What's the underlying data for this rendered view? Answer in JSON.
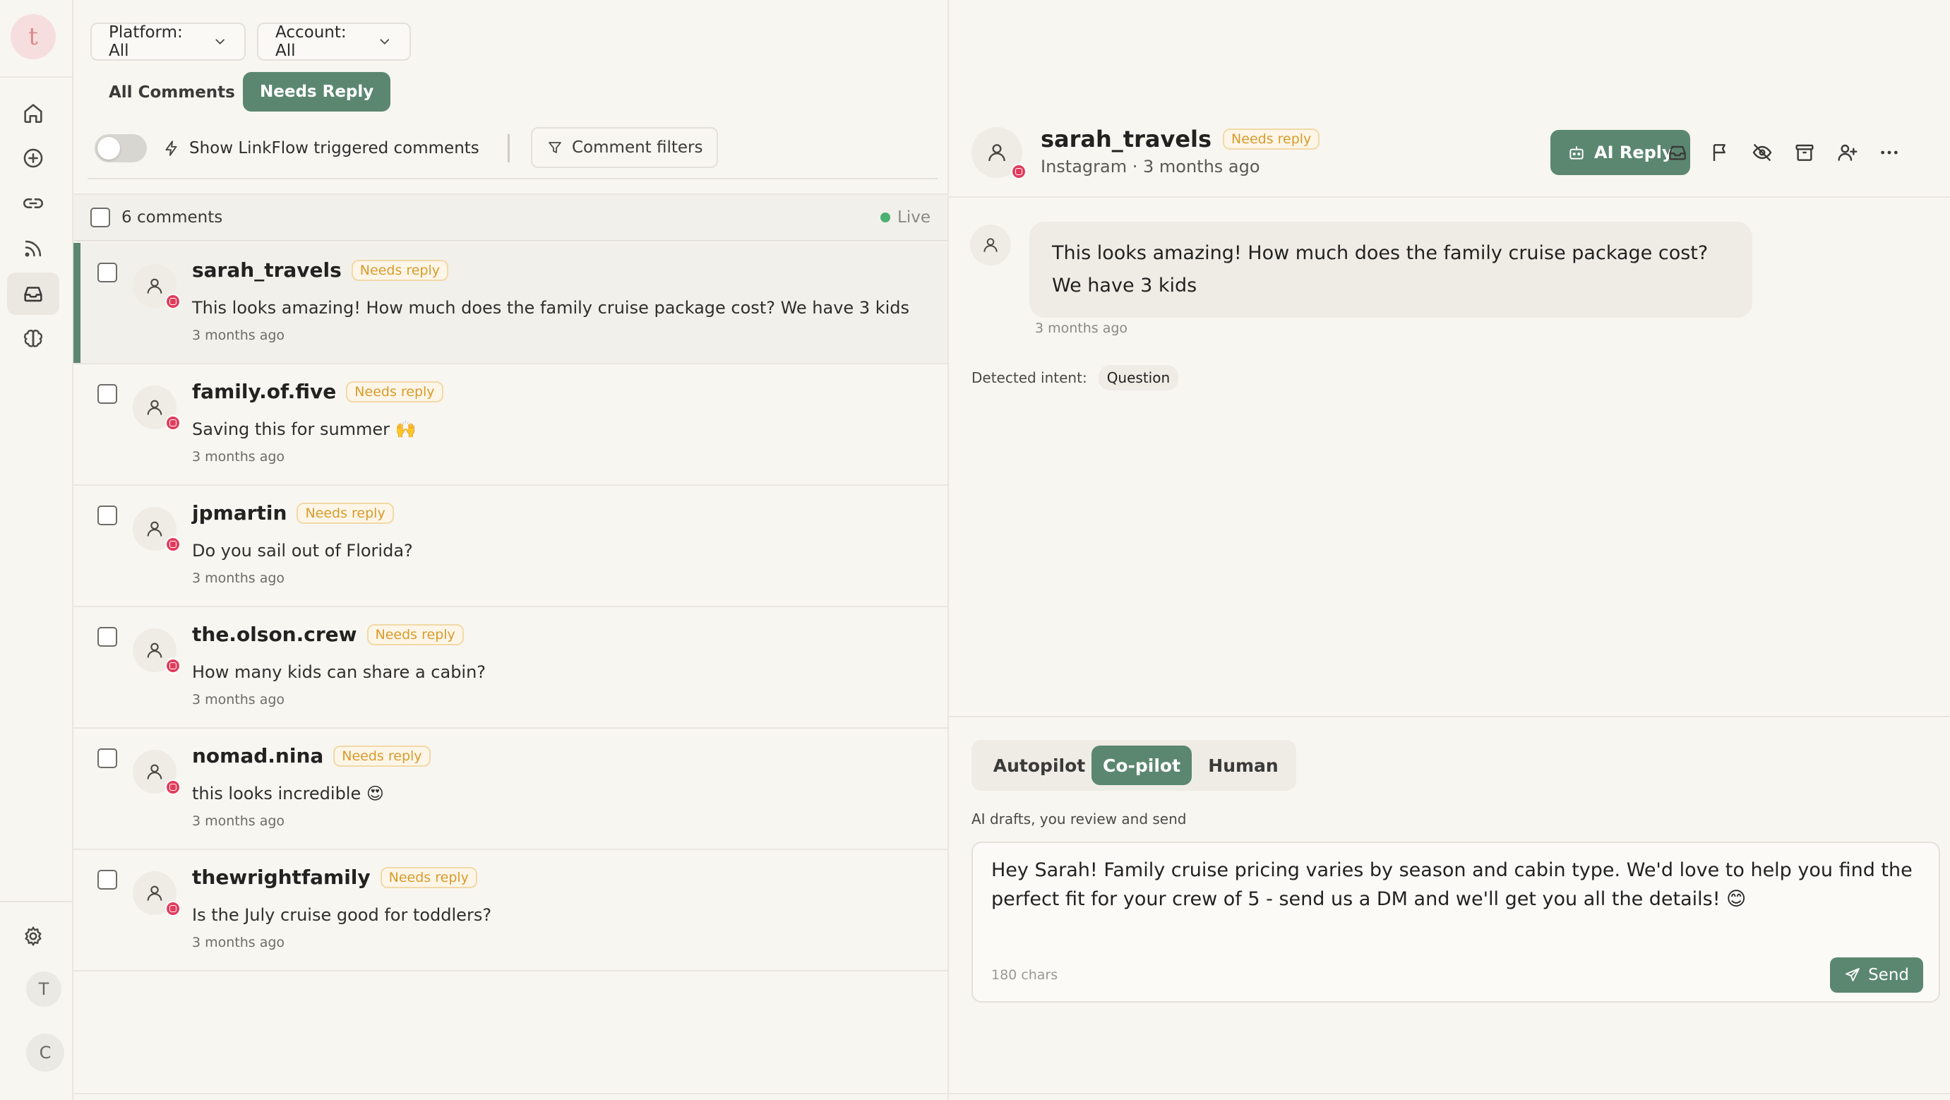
{
  "app": {
    "logo_letter": "t",
    "accent_color": "#5b8770",
    "instagram_color": "#e03d5c"
  },
  "rail": {
    "items": [
      {
        "name": "home",
        "icon": "home-icon"
      },
      {
        "name": "create",
        "icon": "plus-circle-icon"
      },
      {
        "name": "links",
        "icon": "link-icon"
      },
      {
        "name": "feed",
        "icon": "rss-icon"
      },
      {
        "name": "inbox",
        "icon": "inbox-icon",
        "active": true
      },
      {
        "name": "brain",
        "icon": "brain-icon"
      }
    ],
    "settings_icon": "gear-icon",
    "avatars": [
      "T",
      "C"
    ]
  },
  "filters": {
    "platform_label": "Platform: All",
    "account_label": "Account: All"
  },
  "tabs": {
    "all": "All Comments",
    "needs_reply": "Needs Reply",
    "active": "needs_reply"
  },
  "toolbar": {
    "linkflow_label": "Show LinkFlow triggered comments",
    "linkflow_on": false,
    "comment_filters_label": "Comment filters"
  },
  "list": {
    "count_label": "6 comments",
    "live_label": "Live",
    "comments": [
      {
        "username": "sarah_travels",
        "status": "Needs reply",
        "text": "This looks amazing! How much does the family cruise package cost? We have 3 kids",
        "time": "3 months ago",
        "selected": true
      },
      {
        "username": "family.of.five",
        "status": "Needs reply",
        "text": "Saving this for summer 🙌",
        "time": "3 months ago"
      },
      {
        "username": "jpmartin",
        "status": "Needs reply",
        "text": "Do you sail out of Florida?",
        "time": "3 months ago"
      },
      {
        "username": "the.olson.crew",
        "status": "Needs reply",
        "text": "How many kids can share a cabin?",
        "time": "3 months ago"
      },
      {
        "username": "nomad.nina",
        "status": "Needs reply",
        "text": "this looks incredible 😍",
        "time": "3 months ago"
      },
      {
        "username": "thewrightfamily",
        "status": "Needs reply",
        "text": "Is the July cruise good for toddlers?",
        "time": "3 months ago"
      }
    ]
  },
  "detail": {
    "username": "sarah_travels",
    "status": "Needs reply",
    "subtitle": "Instagram · 3 months ago",
    "ai_reply_label": "AI Reply",
    "actions": [
      "inbox-icon",
      "flag-icon",
      "eye-off-icon",
      "archive-icon",
      "user-plus-icon",
      "more-icon"
    ],
    "message": "This looks amazing! How much does the family cruise package cost? We have 3 kids",
    "message_time": "3 months ago",
    "intent_label": "Detected intent:",
    "intent_value": "Question"
  },
  "composer": {
    "modes": [
      "Autopilot",
      "Co-pilot",
      "Human"
    ],
    "active_mode": "Co-pilot",
    "mode_description": "AI drafts, you review and send",
    "draft": "Hey Sarah! Family cruise pricing varies by season and cabin type. We'd love to help you find the perfect fit for your crew of 5 - send us a DM and we'll get you all the details! 😊",
    "char_count": "180 chars",
    "send_label": "Send"
  }
}
